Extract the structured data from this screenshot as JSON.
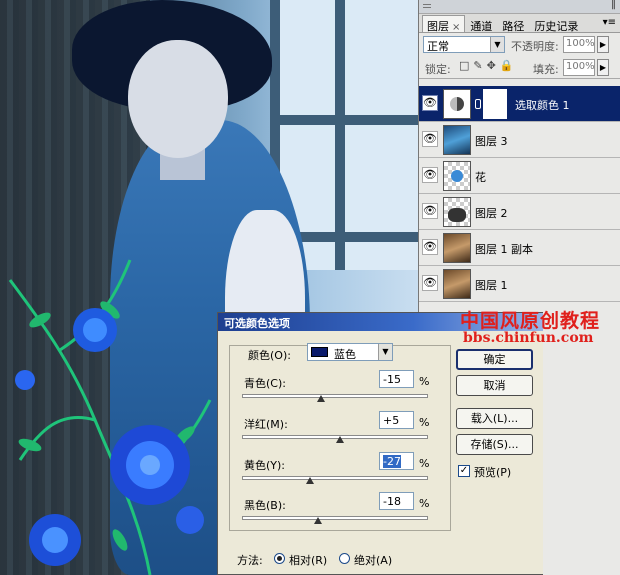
{
  "layers_panel": {
    "tabs": [
      {
        "label": "图层",
        "active": true
      },
      {
        "label": "通道",
        "active": false
      },
      {
        "label": "路径",
        "active": false
      },
      {
        "label": "历史记录",
        "active": false
      }
    ],
    "close_glyph": "×",
    "blend_mode": "正常",
    "opacity_label": "不透明度:",
    "opacity_value": "100%",
    "lock_label": "锁定:",
    "fill_label": "填充:",
    "fill_value": "100%",
    "layers": [
      {
        "name": "选取颜色 1",
        "thumb": "adjustment",
        "has_mask": true,
        "selected": true
      },
      {
        "name": "图层 3",
        "thumb": "photo-blue",
        "selected": false
      },
      {
        "name": "花",
        "thumb": "flower",
        "selected": false
      },
      {
        "name": "图层 2",
        "thumb": "dark-shape",
        "selected": false
      },
      {
        "name": "图层 1 副本",
        "thumb": "photo-warm",
        "selected": false
      },
      {
        "name": "图层 1",
        "thumb": "photo-warm",
        "selected": false
      }
    ],
    "eye_glyph": "👁"
  },
  "dialog": {
    "title": "可选颜色选项",
    "colors_label": "颜色(O):",
    "colors_value": "蓝色",
    "colors_swatch": "#0a1a6a",
    "sliders": [
      {
        "label": "青色(C):",
        "value": "-15",
        "level": -15
      },
      {
        "label": "洋红(M):",
        "value": "+5",
        "level": 5
      },
      {
        "label": "黄色(Y):",
        "value": "-27",
        "level": -27
      },
      {
        "label": "黑色(B):",
        "value": "-18",
        "level": -18
      }
    ],
    "percent": "%",
    "buttons": {
      "ok": "确定",
      "cancel": "取消",
      "load": "载入(L)...",
      "save": "存储(S)..."
    },
    "preview_label": "预览(P)",
    "preview_checked": true,
    "method_label": "方法:",
    "method_options": [
      {
        "label": "相对(R)",
        "selected": true
      },
      {
        "label": "绝对(A)",
        "selected": false
      }
    ]
  },
  "watermark": {
    "title": "中国风原创教程",
    "url": "bbs.chinfun.com",
    "color": "#e0201c"
  }
}
